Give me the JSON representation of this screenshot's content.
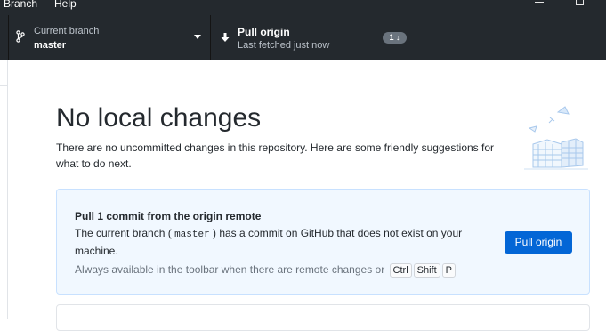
{
  "menu": {
    "branch": "Branch",
    "help": "Help"
  },
  "toolbar": {
    "branch": {
      "label": "Current branch",
      "value": "master",
      "icon": "git-branch-icon"
    },
    "pull": {
      "title": "Pull origin",
      "subtitle": "Last fetched just now",
      "badge": "1",
      "icon": "arrow-down-icon"
    }
  },
  "main": {
    "title": "No local changes",
    "description": "There are no uncommitted changes in this repository. Here are some friendly suggestions for what to do next.",
    "card": {
      "title": "Pull 1 commit from the origin remote",
      "desc_before": "The current branch ( ",
      "branch_code": "master",
      "desc_after": " ) has a commit on GitHub that does not exist on your machine.",
      "hint": "Always available in the toolbar when there are remote changes or",
      "shortcut": [
        "Ctrl",
        "Shift",
        "P"
      ],
      "button": "Pull origin"
    }
  },
  "colors": {
    "toolbar": "#24292e",
    "accent": "#0366d6",
    "card_bg": "#f1f8ff"
  }
}
